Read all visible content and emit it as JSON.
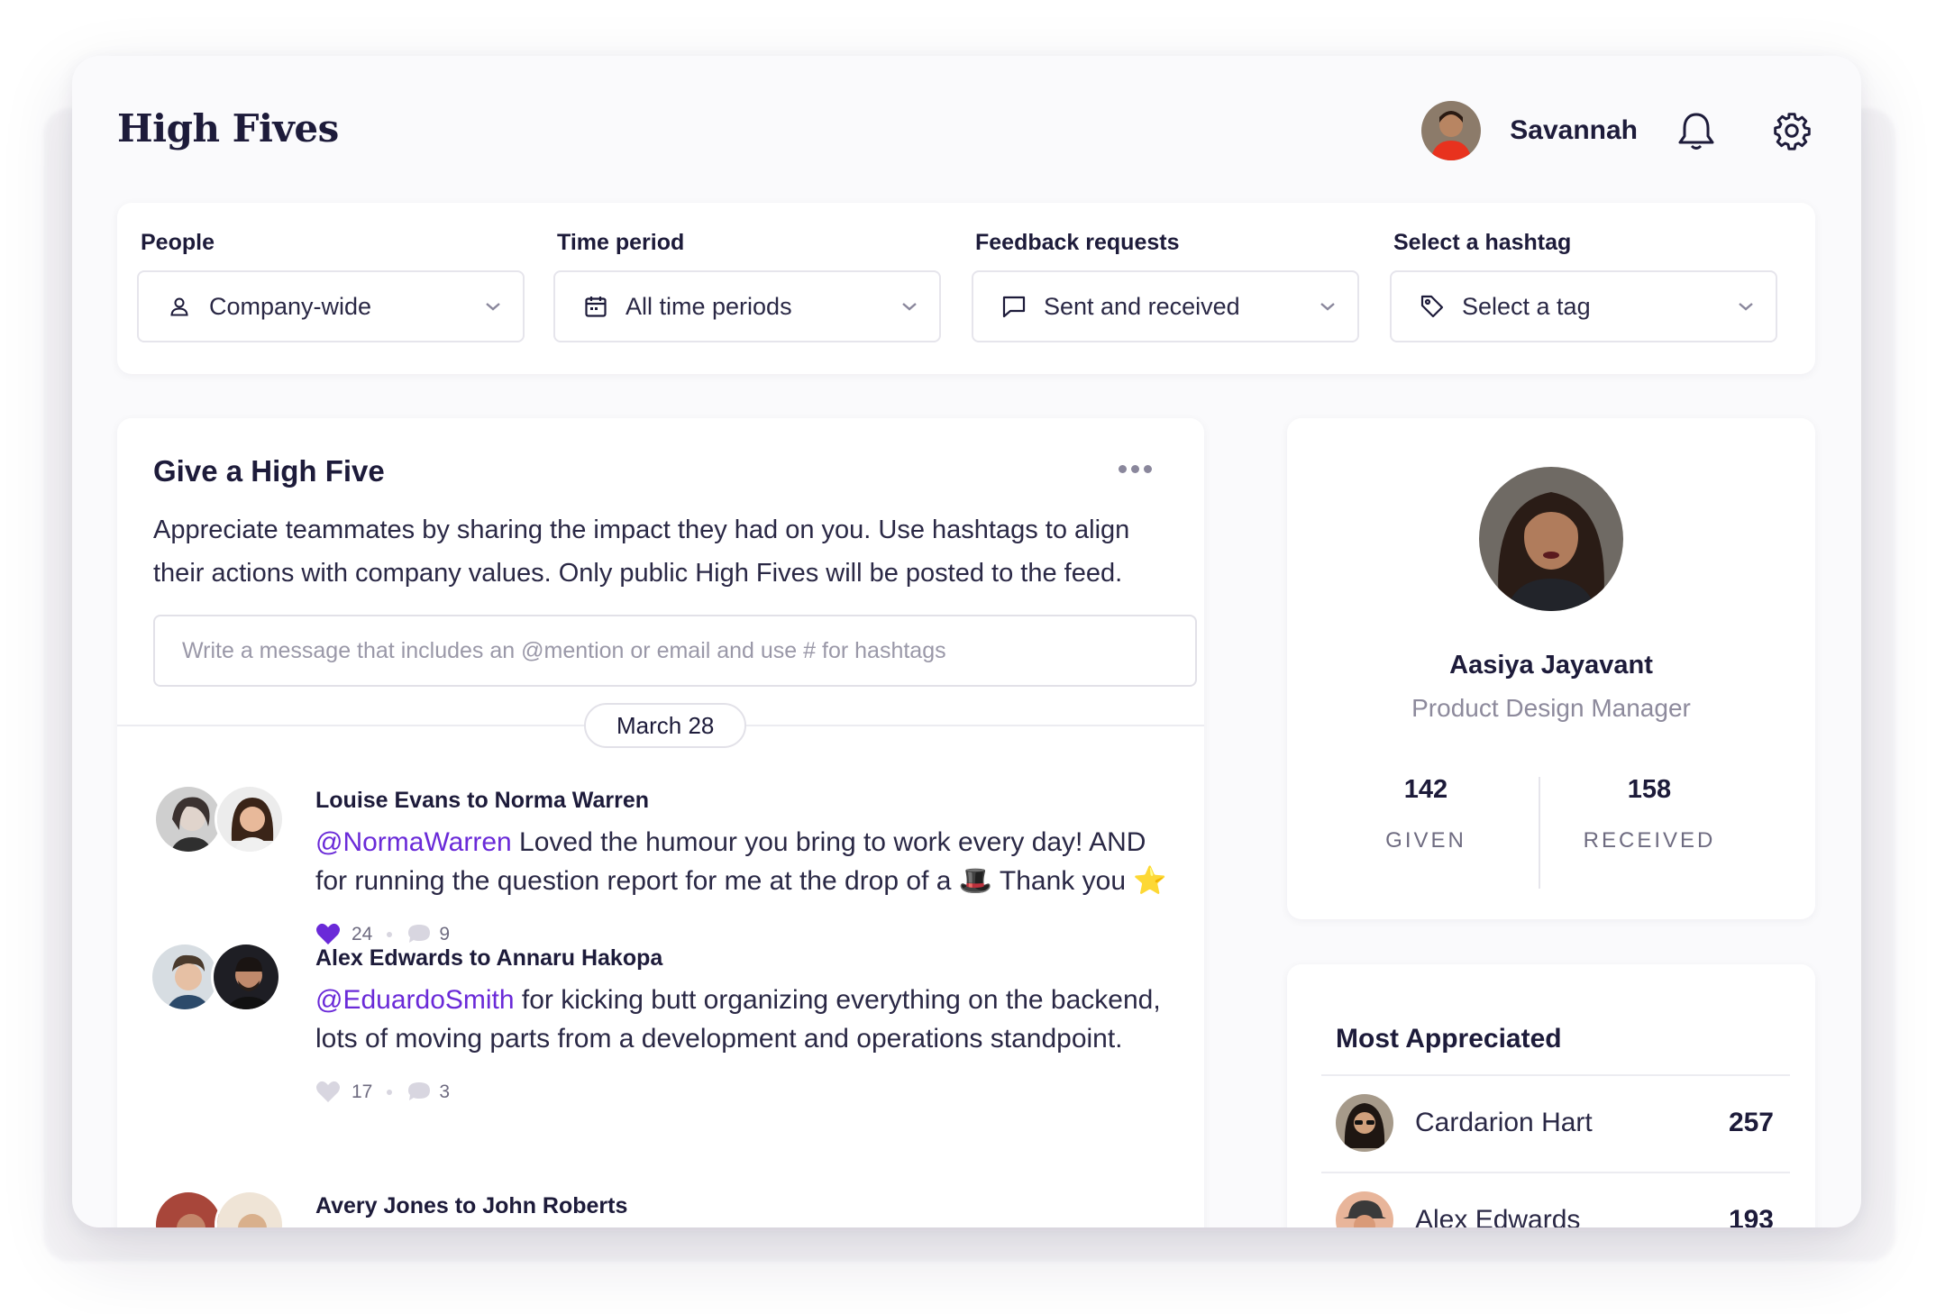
{
  "app": {
    "title": "High Fives"
  },
  "user": {
    "name": "Savannah"
  },
  "filters": [
    {
      "label": "People",
      "value": "Company-wide",
      "icon": "person-icon"
    },
    {
      "label": "Time period",
      "value": "All time periods",
      "icon": "calendar-icon"
    },
    {
      "label": "Feedback requests",
      "value": "Sent and received",
      "icon": "message-icon"
    },
    {
      "label": "Select a hashtag",
      "value": "Select a tag",
      "icon": "tag-icon"
    }
  ],
  "give": {
    "title": "Give a High Five",
    "description": "Appreciate teammates by sharing the impact they had on you. Use hashtags to align their actions with company values. Only public High Fives will be posted to the feed.",
    "placeholder": "Write a message that includes an @mention or email and use # for hashtags"
  },
  "feed": {
    "date": "March 28",
    "posts": [
      {
        "header": "Louise Evans to Norma Warren",
        "mention": "@NormaWarren",
        "text": " Loved the humour you bring to work every day! AND for running the question report for me at the drop of a ",
        "emoji1": "🎩",
        "text2": " Thank you ",
        "emoji2": "⭐",
        "likes": "24",
        "comments": "9",
        "liked": true
      },
      {
        "header": "Alex Edwards to Annaru Hakopa",
        "mention": "@EduardoSmith",
        "text": " for kicking butt organizing everything on the backend, lots of moving parts from a development and operations standpoint.",
        "likes": "17",
        "comments": "3",
        "liked": false
      },
      {
        "header": "Avery Jones to John Roberts"
      }
    ]
  },
  "profile": {
    "name": "Aasiya Jayavant",
    "role": "Product Design Manager",
    "given": "142",
    "given_label": "GIVEN",
    "received": "158",
    "received_label": "RECEIVED"
  },
  "most_appreciated": {
    "title": "Most Appreciated",
    "people": [
      {
        "name": "Cardarion Hart",
        "count": "257"
      },
      {
        "name": "Alex Edwards",
        "count": "193"
      }
    ]
  },
  "colors": {
    "accent": "#6a2ad8",
    "text": "#1d1b3a",
    "muted": "#8d8a9c"
  }
}
